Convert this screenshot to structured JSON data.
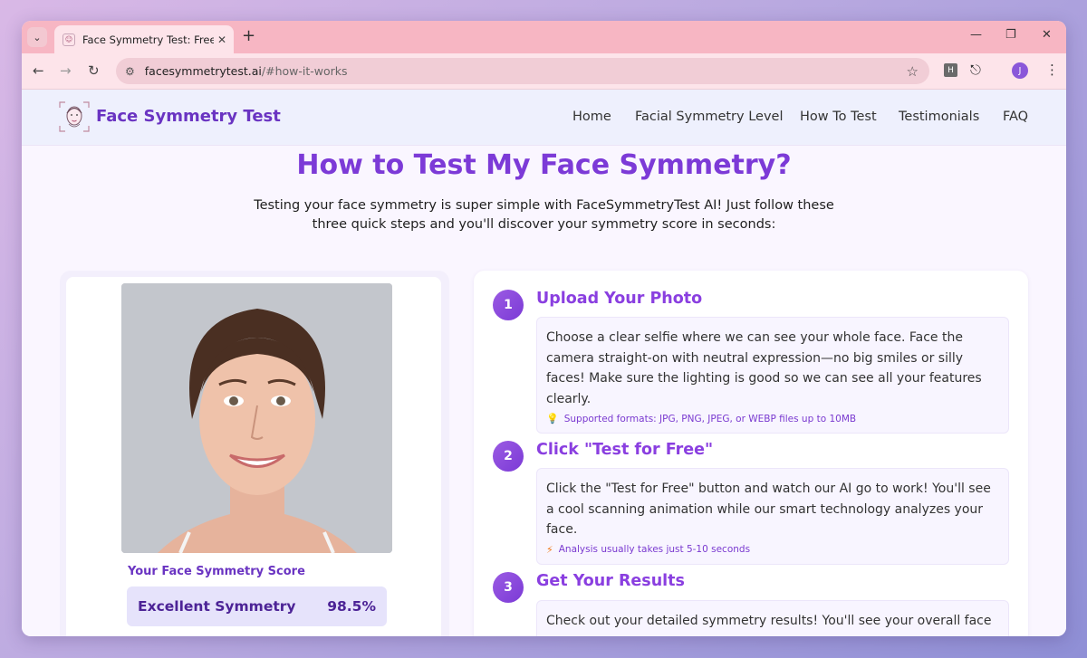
{
  "browser": {
    "tab_title": "Face Symmetry Test: Free Online",
    "url_host": "facesymmetrytest.ai",
    "url_path": "/#how-it-works",
    "profile_initial": "J",
    "ext_letter": "H"
  },
  "site": {
    "logo_text": "Face Symmetry Test",
    "nav": [
      "Home",
      "Facial Symmetry Level",
      "How To Test",
      "Testimonials",
      "FAQ"
    ]
  },
  "hero": {
    "title": "How to Test My Face Symmetry?",
    "subtitle": "Testing your face symmetry is super simple with FaceSymmetryTest AI! Just follow these three quick steps and you'll discover your symmetry score in seconds:"
  },
  "score": {
    "label": "Your Face Symmetry Score",
    "rating": "Excellent Symmetry",
    "value": "98.5%"
  },
  "steps": [
    {
      "num": "1",
      "title": "Upload Your Photo",
      "desc": "Choose a clear selfie where we can see your whole face. Face the camera straight-on with neutral expression—no big smiles or silly faces! Make sure the lighting is good so we can see all your features clearly.",
      "note": "Supported formats: JPG, PNG, JPEG, or WEBP files up to 10MB",
      "note_icon": "lightbulb-icon"
    },
    {
      "num": "2",
      "title": "Click \"Test for Free\"",
      "desc": "Click the \"Test for Free\" button and watch our AI go to work! You'll see a cool scanning animation while our smart technology analyzes your face.",
      "note": "Analysis usually takes just 5-10 seconds",
      "note_icon": "lightning-icon"
    },
    {
      "num": "3",
      "title": "Get Your Results",
      "desc": "Check out your detailed symmetry results! You'll see your overall face"
    }
  ],
  "colors": {
    "accent": "#8a3fe0",
    "tabstrip": "#f7b6c3"
  }
}
